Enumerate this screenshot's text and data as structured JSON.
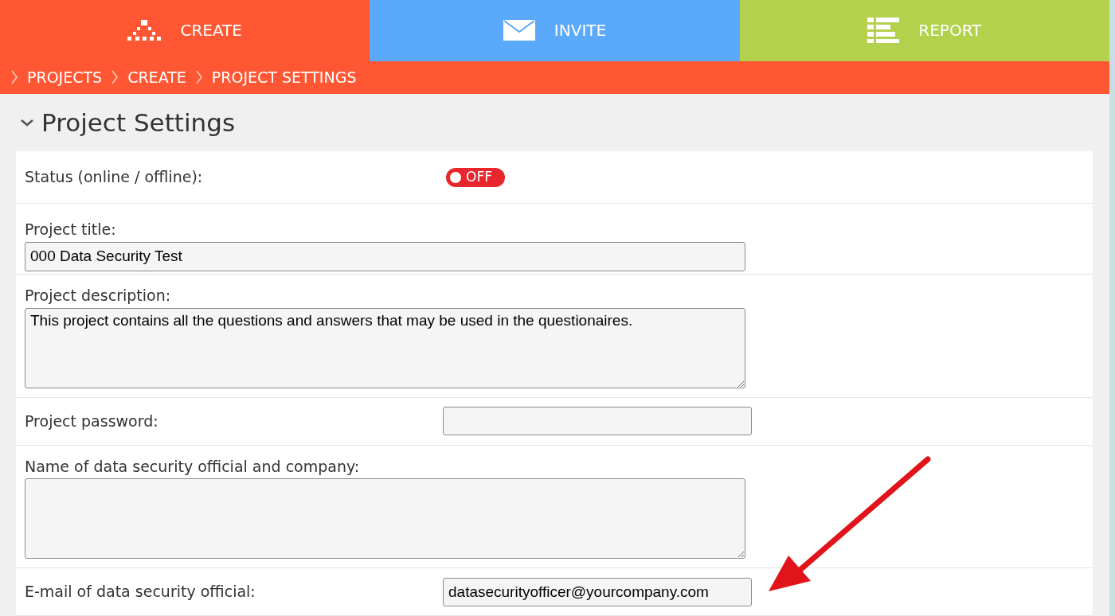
{
  "nav_tabs": [
    {
      "label": "CREATE",
      "color": "#ff5733"
    },
    {
      "label": "INVITE",
      "color": "#5aa9fa"
    },
    {
      "label": "REPORT",
      "color": "#b3d14d"
    }
  ],
  "breadcrumb": [
    "PROJECTS",
    "CREATE",
    "PROJECT SETTINGS"
  ],
  "section": {
    "title": "Project Settings",
    "expanded": true
  },
  "fields": [
    {
      "kind": "toggle",
      "label": "Status (online / offline):",
      "on": false,
      "state_text": "OFF"
    },
    {
      "kind": "text",
      "label": "Project title:",
      "value": "000 Data Security Test"
    },
    {
      "kind": "textarea",
      "label": "Project description:",
      "value": "This project contains all the questions and answers that may be used in the questionaires."
    },
    {
      "kind": "inline",
      "label": "Project password:"
    },
    {
      "kind": "textarea",
      "label": "Name of data security official and company:"
    },
    {
      "kind": "inline",
      "label": "E-mail of data security official:",
      "value": "datasecurityofficer@yourcompany.com"
    }
  ]
}
